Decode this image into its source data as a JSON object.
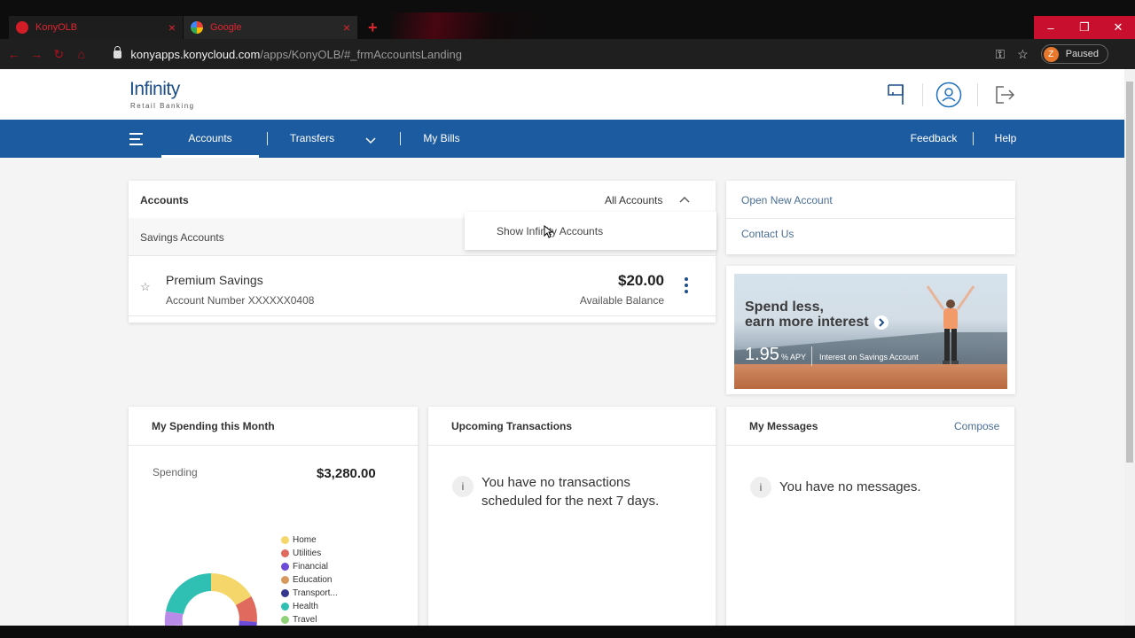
{
  "browser": {
    "tabs": [
      {
        "title": "KonyOLB",
        "active": false
      },
      {
        "title": "Google",
        "active": true
      }
    ],
    "url_host": "konyapps.konycloud.com",
    "url_path": "/apps/KonyOLB/#_frmAccountsLanding",
    "profile_initial": "Z",
    "profile_status": "Paused"
  },
  "brand": {
    "name": "Infinity",
    "tagline": "Retail Banking",
    "color": "#1d5ba0"
  },
  "header_icons": [
    "flag-icon",
    "user-icon",
    "logout-icon"
  ],
  "nav": {
    "items": [
      {
        "label": "Accounts",
        "active": true
      },
      {
        "label": "Transfers",
        "active": false
      },
      {
        "label": "My Bills",
        "active": false
      }
    ],
    "right": [
      {
        "label": "Feedback"
      },
      {
        "label": "Help"
      }
    ]
  },
  "accounts": {
    "title": "Accounts",
    "filter_label": "All Accounts",
    "filter_menu": [
      "Show Infinity Accounts"
    ],
    "section": "Savings Accounts",
    "items": [
      {
        "name": "Premium Savings",
        "number": "Account Number XXXXXX0408",
        "balance": "$20.00",
        "balance_label": "Available Balance"
      }
    ]
  },
  "quick_links": [
    "Open New Account",
    "Contact Us"
  ],
  "promo": {
    "headline_line1": "Spend less,",
    "headline_line2": "earn more interest",
    "rate": "1.95",
    "rate_suffix": "% APY",
    "note": "Interest on Savings Account"
  },
  "spending": {
    "title": "My Spending this Month",
    "label": "Spending",
    "amount": "$3,280.00",
    "legend": [
      {
        "label": "Home",
        "color": "#f5d66b"
      },
      {
        "label": "Utilities",
        "color": "#e06a5e"
      },
      {
        "label": "Financial",
        "color": "#6c4bd6"
      },
      {
        "label": "Education",
        "color": "#d79a5c"
      },
      {
        "label": "Transport...",
        "color": "#35368e"
      },
      {
        "label": "Health",
        "color": "#2fbfb3"
      },
      {
        "label": "Travel",
        "color": "#8fd27a"
      }
    ]
  },
  "upcoming": {
    "title": "Upcoming Transactions",
    "empty_line1": "You have no transactions",
    "empty_line2": "scheduled for the next 7 days.",
    "info_icon_text": "i"
  },
  "messages": {
    "title": "My Messages",
    "compose_label": "Compose",
    "empty": "You have no messages.",
    "info_icon_text": "i"
  }
}
